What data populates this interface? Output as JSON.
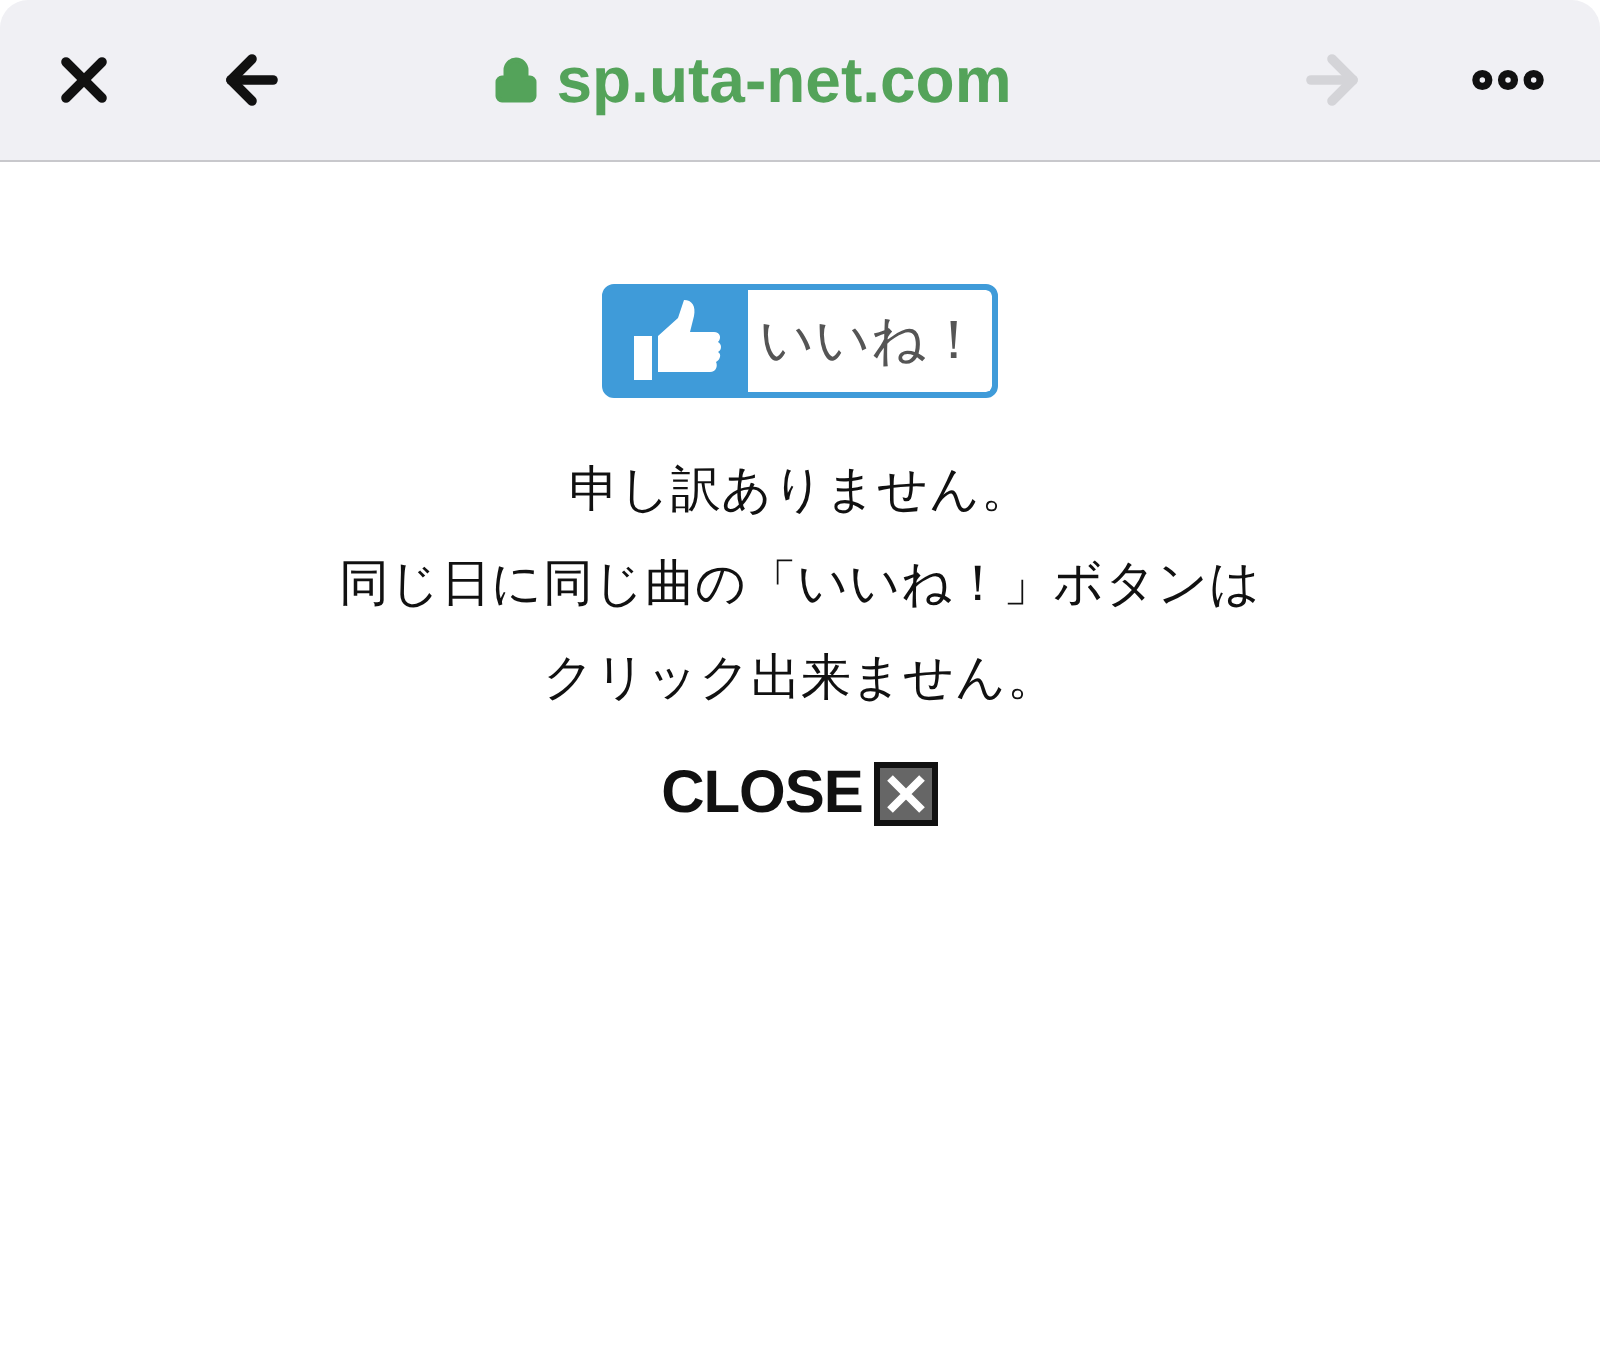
{
  "browser_bar": {
    "url": "sp.uta-net.com",
    "forward_disabled": true
  },
  "like_button": {
    "label": "いいね！"
  },
  "message": [
    "申し訳ありません。",
    "同じ日に同じ曲の「いいね！」ボタンは",
    "クリック出来ません。"
  ],
  "close_button": {
    "label": "CLOSE"
  }
}
